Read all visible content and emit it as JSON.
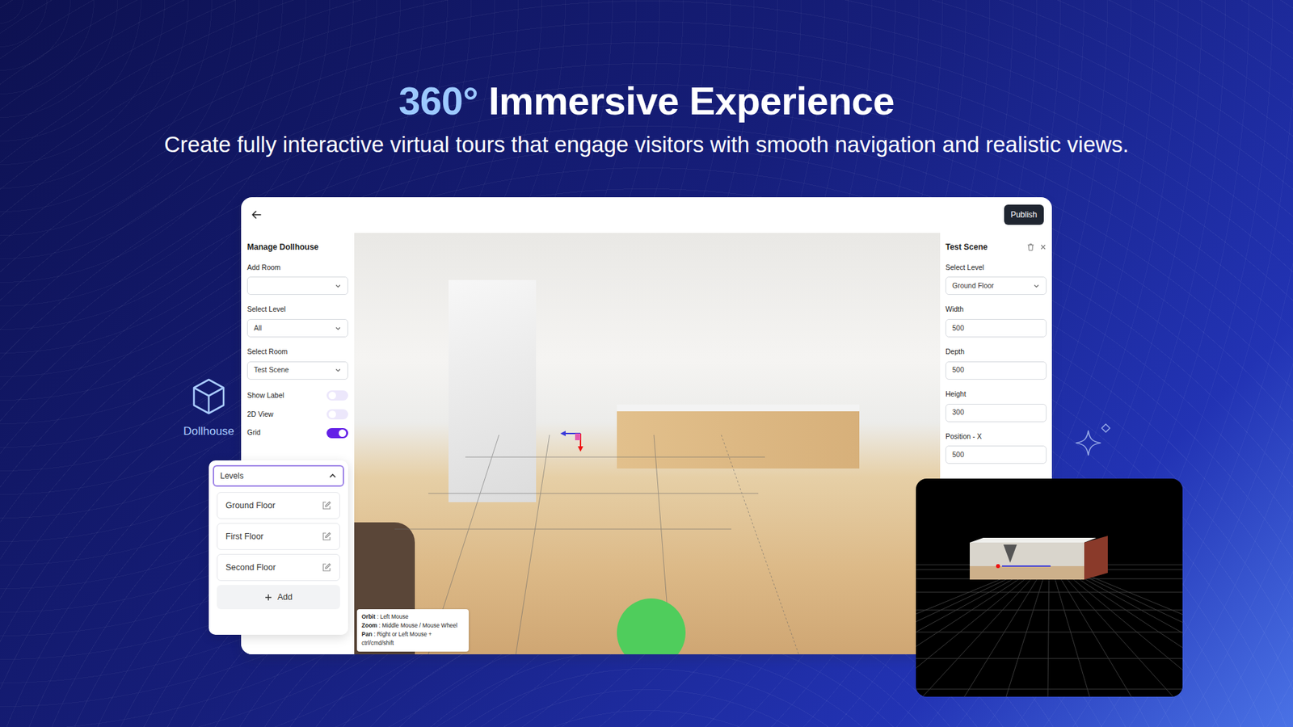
{
  "hero": {
    "title_accent": "360°",
    "title_rest": "Immersive Experience",
    "subtitle": "Create fully interactive virtual tours that engage visitors with smooth navigation and realistic views."
  },
  "app": {
    "publish": "Publish",
    "left_panel": {
      "title": "Manage Dollhouse",
      "fields": [
        {
          "label": "Add Room",
          "value": ""
        },
        {
          "label": "Select Level",
          "value": "All"
        },
        {
          "label": "Select Room",
          "value": "Test Scene"
        }
      ],
      "toggles": [
        {
          "label": "Show Label",
          "on": false
        },
        {
          "label": "2D View",
          "on": false
        },
        {
          "label": "Grid",
          "on": true
        }
      ]
    },
    "right_panel": {
      "title": "Test Scene",
      "fields": [
        {
          "label": "Select Level",
          "value": "Ground Floor",
          "kind": "select"
        },
        {
          "label": "Width",
          "value": "500",
          "kind": "input"
        },
        {
          "label": "Depth",
          "value": "500",
          "kind": "input"
        },
        {
          "label": "Height",
          "value": "300",
          "kind": "input"
        },
        {
          "label": "Position - X",
          "value": "500",
          "kind": "input"
        }
      ]
    },
    "help": [
      {
        "action": "Orbit",
        "binding": ": Left Mouse"
      },
      {
        "action": "Zoom",
        "binding": ": Middle Mouse / Mouse Wheel"
      },
      {
        "action": "Pan",
        "binding": ": Right or Left Mouse + ctrl/cmd/shift"
      }
    ]
  },
  "dollhouse": {
    "label": "Dollhouse"
  },
  "levels": {
    "title": "Levels",
    "expanded": true,
    "items": [
      "Ground Floor",
      "First Floor",
      "Second Floor"
    ],
    "add": "Add"
  }
}
